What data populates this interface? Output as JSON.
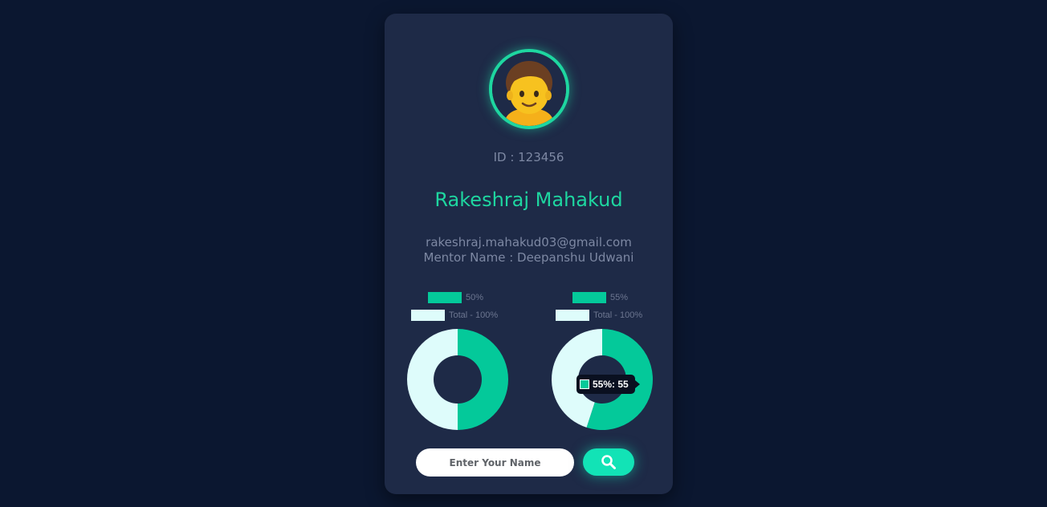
{
  "profile": {
    "id_text": "ID : 123456",
    "name": "Rakeshraj Mahakud",
    "email": "rakeshraj.mahakud03@gmail.com",
    "mentor": "Mentor Name : Deepanshu Udwani",
    "avatar_icon": "person-emoji-icon"
  },
  "colors": {
    "accent": "#1ed6a0",
    "chart_progress": "#04c99a",
    "chart_total": "#defcfb",
    "card": "#1e2a47",
    "background": "#0b1730"
  },
  "chart_data": [
    {
      "type": "pie",
      "title": "",
      "legend_position": "top",
      "labels": [
        "50%",
        "Total - 100%"
      ],
      "values": [
        50,
        50
      ],
      "colors": [
        "#04c99a",
        "#defcfb"
      ]
    },
    {
      "type": "pie",
      "title": "",
      "legend_position": "top",
      "labels": [
        "55%",
        "Total - 100%"
      ],
      "values": [
        55,
        45
      ],
      "colors": [
        "#04c99a",
        "#defcfb"
      ],
      "tooltip": "55%: 55"
    }
  ],
  "search": {
    "placeholder": "Enter Your Name",
    "button_icon": "search-icon"
  }
}
